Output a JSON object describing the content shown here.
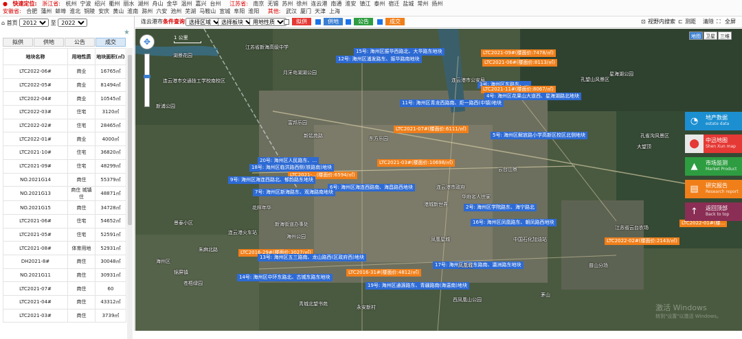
{
  "topbar": {
    "quick_locate": "快速定位:",
    "zhejiang": "浙江省:",
    "zhejiang_cities": [
      "杭州",
      "宁波",
      "绍兴",
      "衢州",
      "丽水",
      "湖州",
      "舟山",
      "金华",
      "温州",
      "嘉兴",
      "台州"
    ],
    "jiangsu": "江苏省:",
    "jiangsu_cities": [
      "南京",
      "无锡",
      "苏州",
      "徐州",
      "连云港",
      "南通",
      "淮安",
      "镇江",
      "泰州",
      "宿迁",
      "盐城",
      "常州",
      "扬州"
    ],
    "anhui": "安徽省:",
    "anhui_cities": [
      "合肥",
      "蒲州",
      "蚌埠",
      "淮北",
      "铜陵",
      "安庆",
      "黄山",
      "淮南",
      "滁州",
      "六安",
      "池州",
      "芜湖",
      "马鞍山",
      "宣城",
      "阜阳",
      "淮阳"
    ],
    "other": "其他:",
    "other_cities": [
      "武汉",
      "厦门",
      "天津",
      "上海"
    ]
  },
  "sidebar": {
    "home": "首页",
    "year_from": "2012",
    "to_label": "至",
    "year_to": "2022",
    "tabs": [
      "拟供",
      "供地",
      "公告",
      "成交"
    ],
    "columns": [
      "地块名称",
      "用地性质",
      "地块面积(㎡)"
    ],
    "rows": [
      [
        "LTC2022-06#",
        "商业",
        "16765㎡"
      ],
      [
        "LTC2022-05#",
        "商业",
        "81494㎡"
      ],
      [
        "LTC2022-04#",
        "商业",
        "10545㎡"
      ],
      [
        "LTC2022-03#",
        "住宅",
        "3120㎡"
      ],
      [
        "LTC2022-02#",
        "住宅",
        "28465㎡"
      ],
      [
        "LTC2022-01#",
        "商业",
        "4000㎡"
      ],
      [
        "LTC2021-10#",
        "住宅",
        "36820㎡"
      ],
      [
        "LTC2021-09#",
        "住宅",
        "48299㎡"
      ],
      [
        "NO.2021G14",
        "商住",
        "55379㎡"
      ],
      [
        "NO.2021G13",
        "商住 城镇住",
        "48871㎡"
      ],
      [
        "NO.2021G15",
        "商住",
        "34728㎡"
      ],
      [
        "LTC2021-06#",
        "住宅",
        "54652㎡"
      ],
      [
        "LTC2021-05#",
        "住宅",
        "52591㎡"
      ],
      [
        "LTC2021-08#",
        "体育用地",
        "52931㎡"
      ],
      [
        "DH2021-8#",
        "商住",
        "30048㎡"
      ],
      [
        "NO.2021G11",
        "商住",
        "30931㎡"
      ],
      [
        "LTC2021-07#",
        "商住",
        "60"
      ],
      [
        "LTC2021-04#",
        "商住",
        "43312㎡"
      ],
      [
        "LTC2021-03#",
        "商住",
        "3739㎡"
      ]
    ]
  },
  "maptool": {
    "city": "连云港市",
    "cond_label": "条件查询",
    "select_area": "选择区域",
    "select_block": "选择板块",
    "select_use": "用地性质",
    "btn_proposed": "拟供",
    "btn_supply": "供地",
    "btn_notice": "公告",
    "btn_deal": "成交",
    "view_search": "视野内搜索",
    "ranging": "测距",
    "clear": "清除",
    "fullscreen": "全屏"
  },
  "map": {
    "map_types": [
      "地图",
      "卫星",
      "三维"
    ],
    "scale": "1 公里",
    "tags": [
      {
        "text": "15号: 海州区振华西路北、大华路东地块",
        "type": "blue"
      },
      {
        "text": "12号: 海州区浦发路东、振华路南地块",
        "type": "blue"
      },
      {
        "text": "LTC2021-09#(楼面价:7478/㎡)",
        "type": "orange"
      },
      {
        "text": "LTC2021-06#(楼面价:8113/㎡)",
        "type": "orange"
      },
      {
        "text": "3号: 海州区东路东、...",
        "type": "blue"
      },
      {
        "text": "LTC2021-11#(楼面价:8067/㎡)",
        "type": "orange"
      },
      {
        "text": "4号: 海州区花果山大道西、星海湖路北地块",
        "type": "blue"
      },
      {
        "text": "11号: 海州区青龙西路南、炬一路西(中镇)地块",
        "type": "blue"
      },
      {
        "text": "LTC2021-07#(楼面价:6111/㎡)",
        "type": "orange"
      },
      {
        "text": "5号: 海州区解放路小学高新区校区北侧地块",
        "type": "blue"
      },
      {
        "text": "20号: 海州区人民路东、...",
        "type": "blue"
      },
      {
        "text": "18号: 海州区临洪路西侧(铁路南)地块",
        "type": "blue"
      },
      {
        "text": "LTC2021-03#(楼面价:10698/㎡)",
        "type": "orange"
      },
      {
        "text": "LTC2021-...(楼面价:6594/㎡)",
        "type": "orange"
      },
      {
        "text": "9号: 海州区海连西路北、郁韵路东地块",
        "type": "blue"
      },
      {
        "text": "6号: 海州区海连西路南、海昌路西地块",
        "type": "blue"
      },
      {
        "text": "7号: 海州区新海路东、观海路南地块",
        "type": "blue"
      },
      {
        "text": "2号: 海州区学院路东、海宁路北",
        "type": "blue"
      },
      {
        "text": "16号: 海州区凤凰路东、朝凤路西地块",
        "type": "blue"
      },
      {
        "text": "LTC2022-01#(楼...",
        "type": "orange"
      },
      {
        "text": "LTC2022-02#(楼面价:2143/㎡)",
        "type": "orange"
      },
      {
        "text": "LTC2016-29#(楼面价:3027/㎡)",
        "type": "orange"
      },
      {
        "text": "13号: 海州区五三路南、龙山路西(区政府西)地块",
        "type": "blue"
      },
      {
        "text": "LTC2016-31#(楼面价:4812/㎡)",
        "type": "orange"
      },
      {
        "text": "17号: 海州区新建东路南、瀛洲路东地块",
        "type": "blue"
      },
      {
        "text": "14号: 海州区中环东路北、古城东路东地块",
        "type": "blue"
      },
      {
        "text": "19号: 海州区通源路东、青疆路南(海温南)地块",
        "type": "blue"
      }
    ],
    "places": [
      "湖景花园",
      "江苏省新海高级中学",
      "月牙岛湖湖公园",
      "连云港市交通技工学校南校区",
      "富邦乐园",
      "新姑苑路",
      "东方乐园",
      "连云港市政府",
      "华府名人世家",
      "港城新世界",
      "花样年华",
      "景泰小区",
      "新海街道办事处",
      "海州公园",
      "连云港火车站",
      "朱麻北路",
      "凤凰星城",
      "海州区",
      "孔望山风景区",
      "青城北望书苑",
      "永安新村",
      "西凤凰山公园",
      "茅山",
      "锦屏镇",
      "苍梧绿园",
      "新浦公园",
      "中国石化加油站",
      "连云港市公安局",
      "星海湖公园",
      "云台山景",
      "孔雀沟风景区",
      "江苏省云台农场",
      "普山分场",
      "凤凰城",
      "大望顶"
    ],
    "side_panel": [
      {
        "title": "地产数据",
        "sub": "estate data",
        "color": "#1c8fd1",
        "icon": "pie"
      },
      {
        "title": "中迅地图",
        "sub": "Shen Xun map",
        "color": "#e8e8e8",
        "icon": "pin"
      },
      {
        "title": "市场监测",
        "sub": "Market Product",
        "color": "#2e9d41",
        "icon": "chart"
      },
      {
        "title": "研究报告",
        "sub": "Research report",
        "color": "#f07f1a",
        "icon": "doc"
      },
      {
        "title": "返回顶部",
        "sub": "Back to top",
        "color": "#8b2e55",
        "icon": "up"
      }
    ],
    "watermark_title": "激活 Windows",
    "watermark_sub": "转到\"设置\"以激活 Windows。"
  }
}
